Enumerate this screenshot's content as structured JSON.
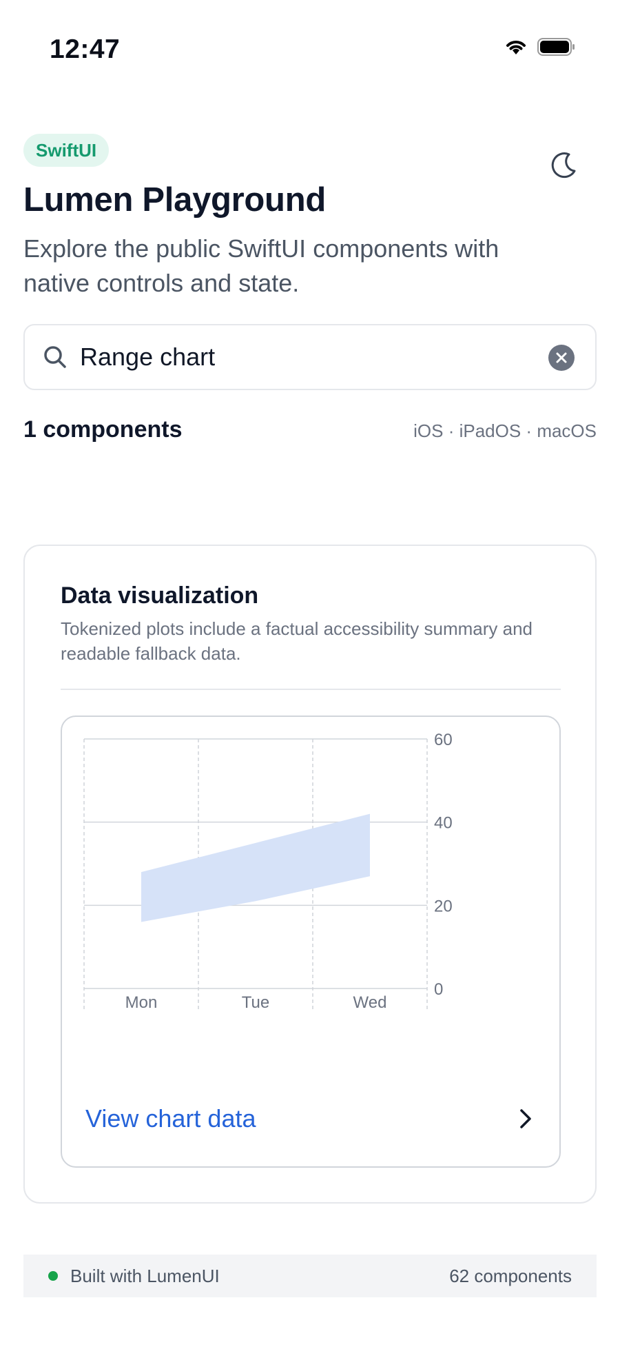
{
  "status_bar": {
    "time": "12:47",
    "icons": [
      "wifi-icon",
      "battery-icon"
    ]
  },
  "header": {
    "badge": "SwiftUI",
    "title": "Lumen Playground",
    "subtitle": "Explore the public SwiftUI components with native controls and state.",
    "theme_icon": "moon-icon"
  },
  "search": {
    "value": "Range chart",
    "placeholder": ""
  },
  "results": {
    "count_label": "1 components",
    "platforms": "iOS · iPadOS · macOS"
  },
  "card": {
    "title": "Data visualization",
    "description": "Tokenized plots include a factual accessibility summary and readable fallback data.",
    "link_label": "View chart data"
  },
  "chart_data": {
    "type": "area",
    "categories": [
      "Mon",
      "Tue",
      "Wed"
    ],
    "series": [
      {
        "low": [
          16,
          21,
          27
        ],
        "high": [
          28,
          35,
          42
        ]
      }
    ],
    "y_ticks": [
      "60",
      "40",
      "20",
      "0"
    ],
    "ylim": [
      0,
      60
    ],
    "grid": true,
    "color": "#d6e2f8"
  },
  "footer": {
    "left": "Built with LumenUI",
    "right": "62 components",
    "status_color": "#16a34a"
  },
  "colors": {
    "accent": "#2563d9",
    "badge_bg": "#e3f6ef",
    "badge_text": "#159a6e"
  }
}
